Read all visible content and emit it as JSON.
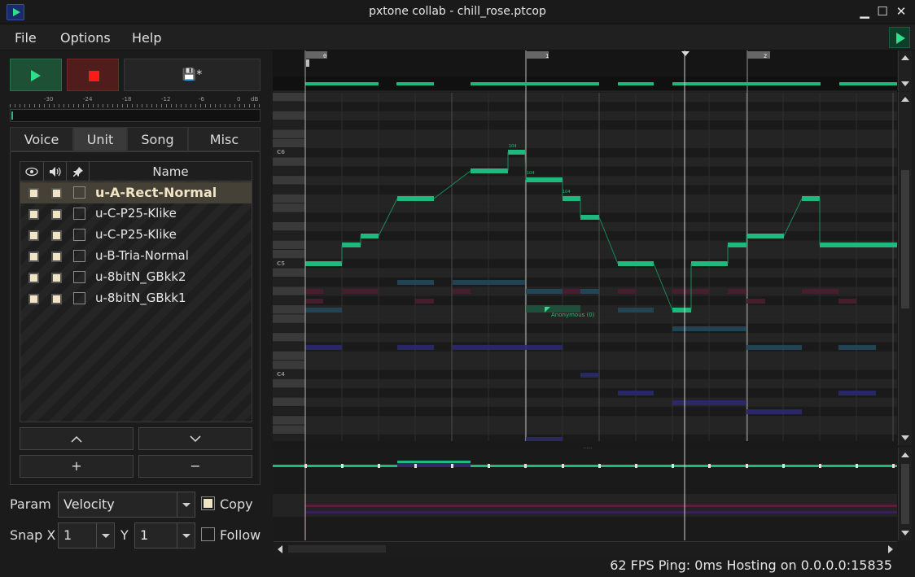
{
  "window": {
    "title": "pxtone collab - chill_rose.ptcop"
  },
  "menu": {
    "file": "File",
    "options": "Options",
    "help": "Help"
  },
  "transport": {
    "save_label": "💾*"
  },
  "meter": {
    "db_labels": [
      "-30",
      "-24",
      "-18",
      "-12",
      "-6",
      "0",
      "dB"
    ]
  },
  "tabs": [
    {
      "label": "Voice"
    },
    {
      "label": "Unit",
      "active": true
    },
    {
      "label": "Song"
    },
    {
      "label": "Misc"
    }
  ],
  "unit_list": {
    "header_name": "Name",
    "header_icons": [
      "eye-icon",
      "speaker-icon",
      "pin-icon"
    ],
    "units": [
      {
        "name": "u-A-Rect-Normal",
        "selected": true
      },
      {
        "name": "u-C-P25-Klike"
      },
      {
        "name": "u-C-P25-Klike"
      },
      {
        "name": "u-B-Tria-Normal"
      },
      {
        "name": "u-8bitN_GBkk2"
      },
      {
        "name": "u-8bitN_GBkk1"
      }
    ],
    "up_label": "⌃",
    "down_label": "⌄",
    "add_label": "+",
    "remove_label": "−"
  },
  "params": {
    "param_label": "Param",
    "param_value": "Velocity",
    "copy_label": "Copy",
    "copy_checked": true,
    "snapx_label": "Snap X",
    "snapx_value": "1",
    "y_label": "Y",
    "y_value": "1",
    "follow_label": "Follow",
    "follow_checked": false
  },
  "timeline": {
    "measure_labels": [
      "0",
      "1",
      "2"
    ]
  },
  "piano": {
    "octave_labels": [
      "C6",
      "C5",
      "C4"
    ]
  },
  "note_labels": {
    "velocity_a": "104",
    "velocity_b": "104",
    "velocity_c": "104",
    "user_cursor": "Anonymous (0)"
  },
  "colors": {
    "accent": "#2fe08a",
    "note_primary": "#1fb97e",
    "note_blue": "#22485a",
    "note_red": "#5a1e2a",
    "note_purple": "#2c2a6a"
  },
  "status": {
    "text": "62 FPS Ping: 0ms Hosting on 0.0.0.0:15835"
  }
}
